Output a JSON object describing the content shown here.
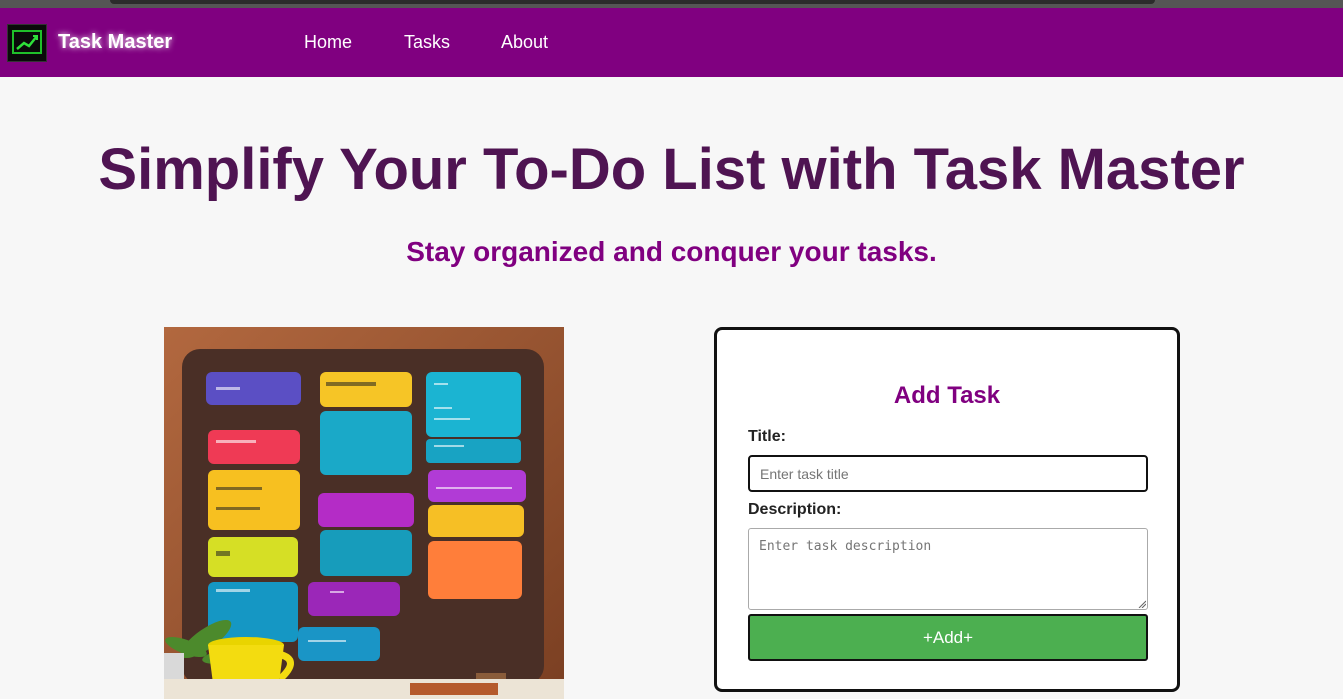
{
  "nav": {
    "brand": "Task Master",
    "links": [
      "Home",
      "Tasks",
      "About"
    ]
  },
  "hero": {
    "title": "Simplify Your To-Do List with Task Master",
    "subtitle": "Stay organized and conquer your tasks."
  },
  "form": {
    "heading": "Add Task",
    "title_label": "Title:",
    "title_placeholder": "Enter task title",
    "description_label": "Description:",
    "description_placeholder": "Enter task description",
    "submit_label": "+Add+"
  },
  "colors": {
    "nav_background": "#800080",
    "heading": "#4f1452",
    "accent": "#800080",
    "button": "#4caf50"
  },
  "icons": [
    "trend-chart-icon"
  ]
}
